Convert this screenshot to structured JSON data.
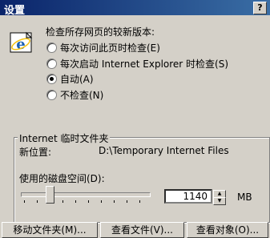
{
  "window": {
    "title": "设置",
    "help_label": "?"
  },
  "check_prompt": "检查所存网页的较新版本:",
  "options": [
    {
      "label": "每次访问此页时检查(E)",
      "selected": false
    },
    {
      "label": "每次启动 Internet Explorer 时检查(S)",
      "selected": false
    },
    {
      "label": "自动(A)",
      "selected": true
    },
    {
      "label": "不检查(N)",
      "selected": false
    }
  ],
  "temp_folder": {
    "group_label": "Internet 临时文件夹",
    "location_label": "新位置:",
    "location_value": "D:\\Temporary Internet Files",
    "disk_space_label": "使用的磁盘空间(D):",
    "slider_level": 0.2,
    "size_value": "1140",
    "size_unit": "MB"
  },
  "buttons": {
    "move_folder": "移动文件夹(M)...",
    "view_files": "查看文件(V)...",
    "view_objects": "查看对象(O)..."
  }
}
